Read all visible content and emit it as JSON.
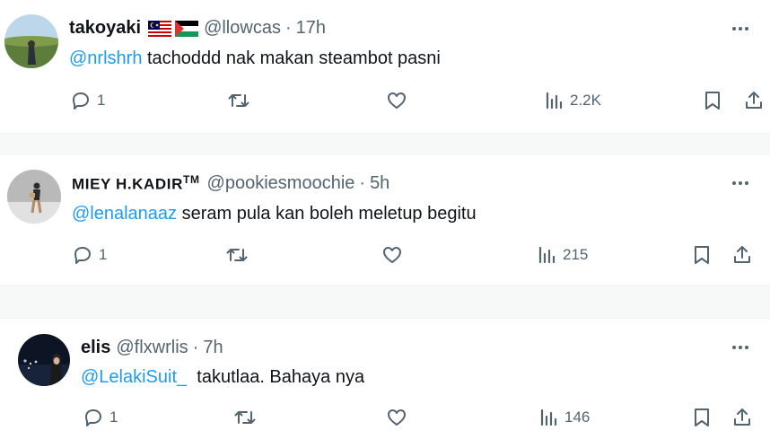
{
  "tweets": [
    {
      "name": "takoyaki",
      "name_suffix": "",
      "handle": "@llowcas",
      "separator": "·",
      "time": "17h",
      "mention": "@nrlshrh",
      "text": " tachoddd nak makan steambot pasni",
      "replies": "1",
      "views": "2.2K"
    },
    {
      "name": "MIEY H.KADIR",
      "name_suffix": "TM",
      "handle": "@pookiesmoochie",
      "separator": "·",
      "time": "5h",
      "mention": "@lenalanaaz",
      "text": " seram pula kan boleh meletup begitu",
      "replies": "1",
      "views": "215"
    },
    {
      "name": "elis",
      "name_suffix": "",
      "handle": "@flxwrlis",
      "separator": "·",
      "time": "7h",
      "mention": "@LelakiSuit_",
      "text": "  takutlaa. Bahaya nya",
      "replies": "1",
      "views": "146"
    }
  ],
  "icons": {
    "reply": "reply-icon",
    "retweet": "retweet-icon",
    "like": "heart-icon",
    "views": "views-icon",
    "bookmark": "bookmark-icon",
    "share": "share-icon",
    "more": "more-icon",
    "flag_1": "malaysia-flag-icon",
    "flag_2": "palestine-flag-icon"
  },
  "colors": {
    "mention": "#1d9bf0",
    "secondary_text": "#536471",
    "primary_text": "#0f1419"
  }
}
